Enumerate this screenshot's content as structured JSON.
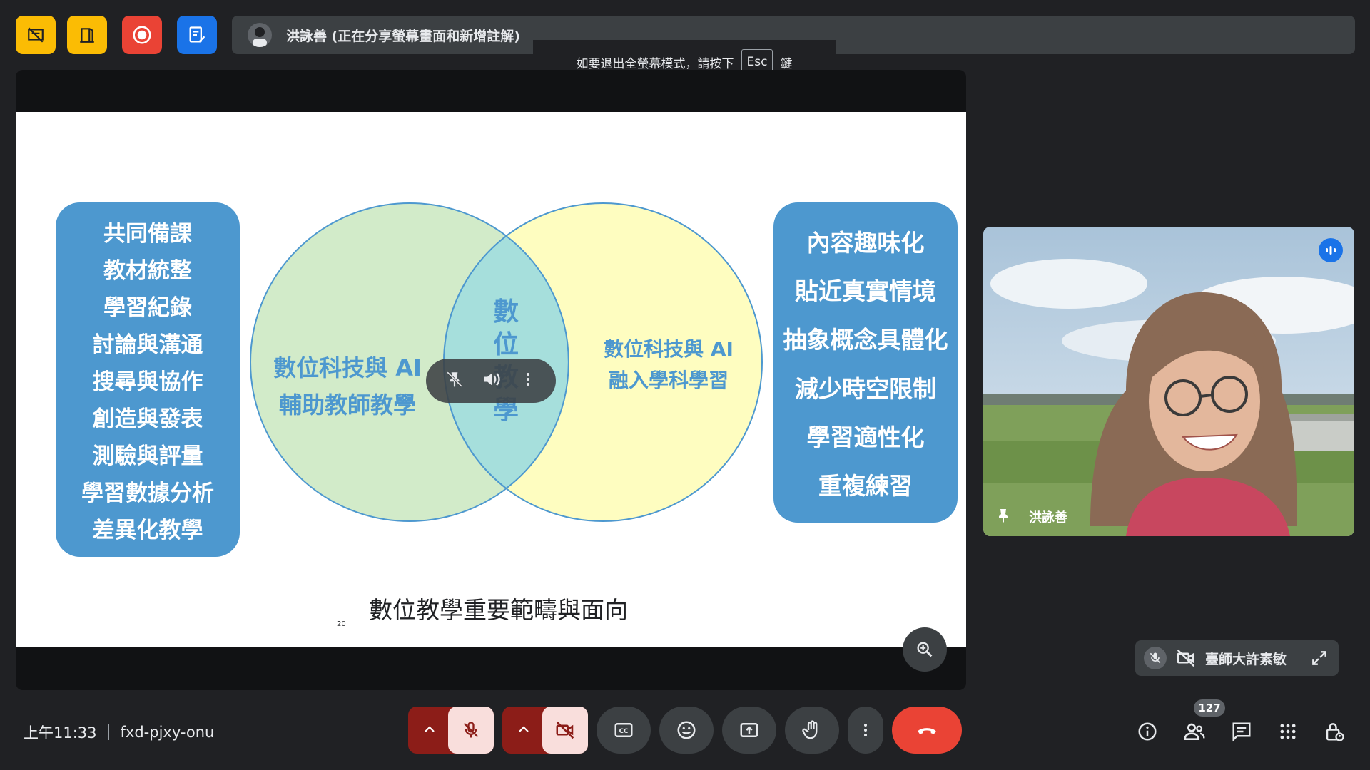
{
  "colors": {
    "background": "#202124",
    "yellow_button": "#fbbc04",
    "red_button": "#ea4335",
    "blue_button": "#1a73e8",
    "slide_blue": "#4d98cf",
    "venn_green": "#d2ebc9",
    "venn_yellow": "#fefdc0",
    "venn_overlap": "#a6dfdc",
    "end_call": "#ea4335",
    "muted_bg": "#8c1d18",
    "muted_inner": "#f9dedc"
  },
  "top_controls": {
    "icons": [
      "no-slides-icon",
      "door-icon",
      "record-icon",
      "whiteboard-icon"
    ]
  },
  "presenter": {
    "banner_text": "洪詠善 (正在分享螢幕畫面和新增註解)"
  },
  "esc_toast": {
    "prefix": "如要退出全螢幕模式，請按下",
    "key": "Esc",
    "suffix": "鍵"
  },
  "slide": {
    "left_list": [
      "共同備課",
      "教材統整",
      "學習紀錄",
      "討論與溝通",
      "搜尋與協作",
      "創造與發表",
      "測驗與評量",
      "學習數據分析",
      "差異化教學"
    ],
    "right_list": [
      "內容趣味化",
      "貼近真實情境",
      "抽象概念具體化",
      "減少時空限制",
      "學習適性化",
      "重複練習"
    ],
    "venn_left": [
      "數位科技與 AI",
      "輔助教師教學"
    ],
    "venn_center": [
      "數",
      "位",
      "教",
      "學"
    ],
    "venn_right": [
      "數位科技與 AI",
      "融入學科學習"
    ],
    "title": "數位教學重要範疇與面向",
    "page_number": "20"
  },
  "video_tile": {
    "name": "洪詠善"
  },
  "mini_tile": {
    "name": "臺師大許素敏"
  },
  "meeting": {
    "time": "上午11:33",
    "code": "fxd-pjxy-onu"
  },
  "people_count": "127"
}
